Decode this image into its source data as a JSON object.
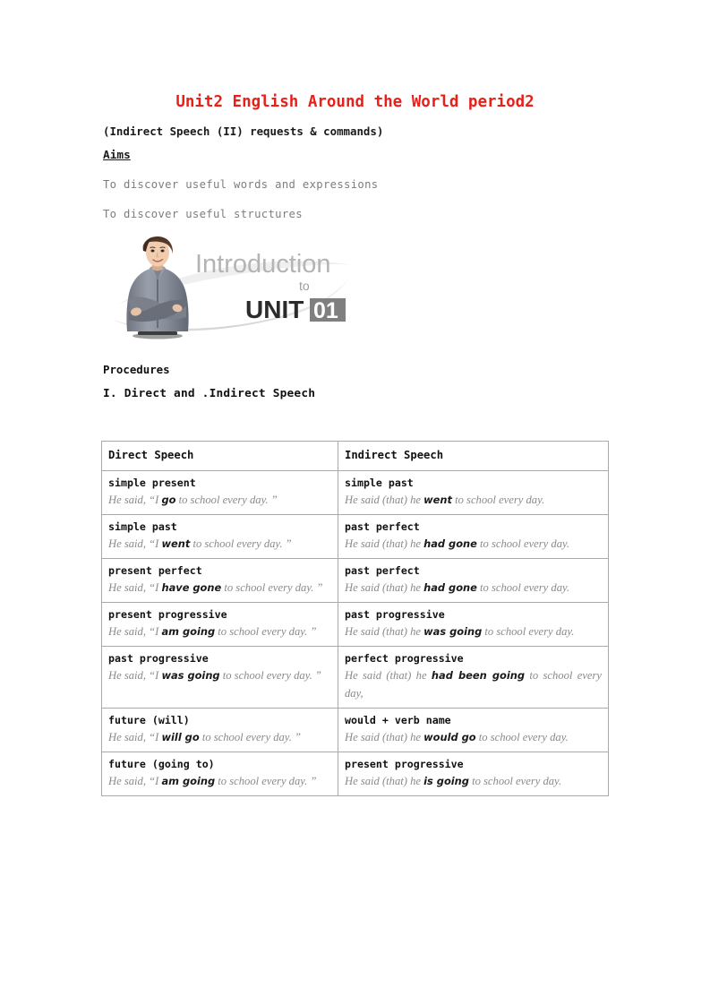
{
  "document": {
    "title": "Unit2 English Around the World period2",
    "subtitle": "(Indirect Speech (II) requests & commands)",
    "aims_heading": "Aims",
    "aims": [
      "To discover useful words and expressions",
      "To discover useful structures"
    ],
    "procedures_heading": "Procedures",
    "section_heading": "I. Direct and .Indirect Speech"
  },
  "illustration": {
    "word_intro": "Introduction",
    "word_to": "to",
    "word_unit": "UNIT",
    "badge_number": "01",
    "alt": "photo of smiling woman with crossed arms beside Introduction to UNIT 01 title"
  },
  "colors": {
    "title_red": "#E8201A",
    "body_gray": "#7d7d7d",
    "example_gray": "#8a8a8a",
    "table_border": "#a9a9a9",
    "badge_gray": "#808080",
    "intro_gray": "#b0b0b0"
  },
  "table": {
    "headers": [
      "Direct Speech",
      "Indirect Speech"
    ],
    "rows": [
      {
        "direct_label": "simple present",
        "direct_pre": "He said, “I ",
        "direct_bold": "go",
        "direct_post": " to school every day. ”",
        "indirect_label": "simple past",
        "indirect_pre": "He said (that) he ",
        "indirect_bold": "went",
        "indirect_post": " to school every day."
      },
      {
        "direct_label": "simple past",
        "direct_pre": "He said, “I ",
        "direct_bold": "went",
        "direct_post": " to school every day. ”",
        "indirect_label": "past perfect",
        "indirect_pre": "He said (that) he ",
        "indirect_bold": "had gone",
        "indirect_post": " to school every day."
      },
      {
        "direct_label": "present perfect",
        "direct_pre": "He said, “I ",
        "direct_bold": "have gone",
        "direct_post": " to school every day. ”",
        "indirect_label": "past perfect",
        "indirect_pre": "He said (that) he ",
        "indirect_bold": "had gone",
        "indirect_post": " to school every day."
      },
      {
        "direct_label": "present progressive",
        "direct_pre": "He said, “I ",
        "direct_bold": "am going",
        "direct_post": " to school every day. ”",
        "indirect_label": "past progressive",
        "indirect_pre": "He said (that) he ",
        "indirect_bold": "was going",
        "indirect_post": " to school every day."
      },
      {
        "direct_label": "past progressive",
        "direct_pre": "He said, “I ",
        "direct_bold": "was going",
        "direct_post": " to school every day. ”",
        "indirect_label": "perfect progressive",
        "indirect_pre": "He said (that) he ",
        "indirect_bold": "had been going",
        "indirect_post": " to school every day,"
      },
      {
        "direct_label": "future (will)",
        "direct_pre": "He said, “I ",
        "direct_bold": "will go",
        "direct_post": " to school every day. ”",
        "indirect_label": "would + verb name",
        "indirect_pre": "He said (that) he ",
        "indirect_bold": "would go",
        "indirect_post": " to school every day."
      },
      {
        "direct_label": "future (going to)",
        "direct_pre": "He said, “I ",
        "direct_bold": "am going",
        "direct_post": " to school every day. ”",
        "indirect_label": "present progressive",
        "indirect_pre": "He said (that) he ",
        "indirect_bold": "is going",
        "indirect_post": " to school every day."
      }
    ]
  }
}
